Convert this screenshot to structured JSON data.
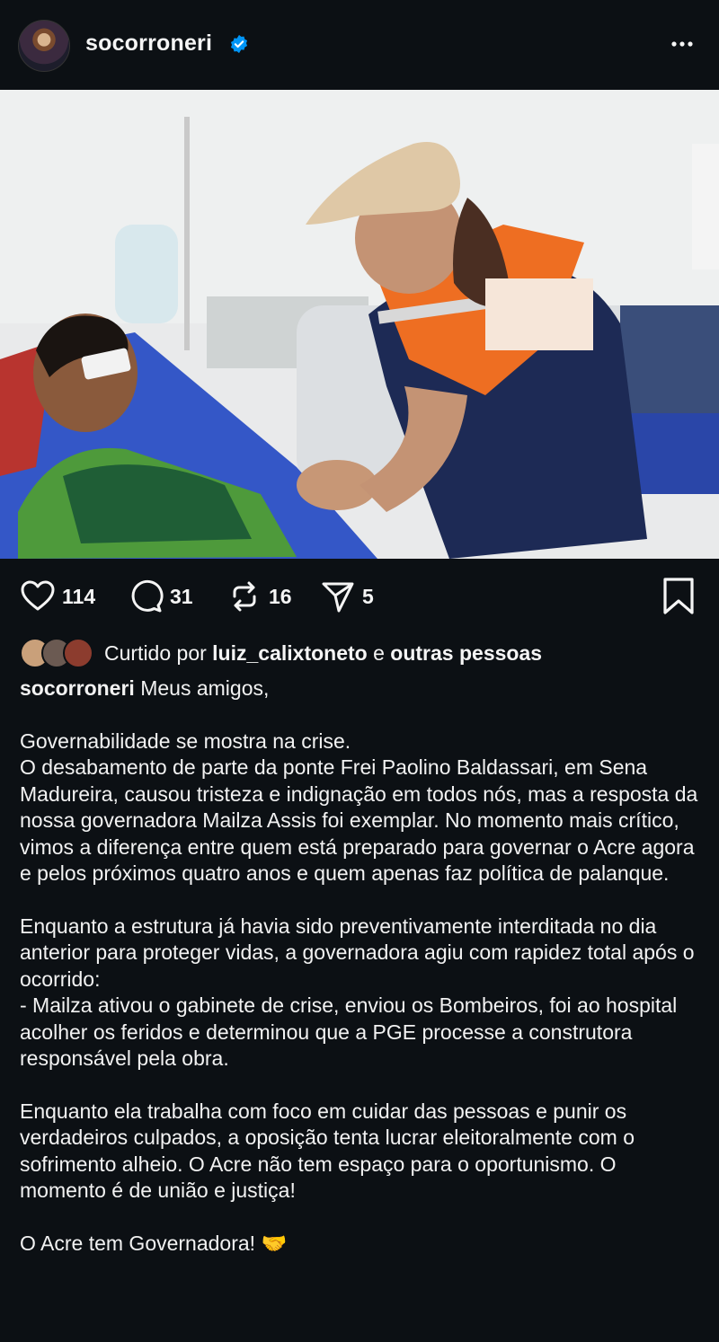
{
  "post": {
    "username": "socorroneri",
    "verified": true
  },
  "actions": {
    "likes": "114",
    "comments": "31",
    "reposts": "16",
    "shares": "5"
  },
  "liked_by": {
    "prefix": "Curtido por",
    "user": "luiz_calixtoneto",
    "connector": "e",
    "others": "outras pessoas"
  },
  "caption": {
    "author": "socorroneri",
    "first_line": "Meus amigos,",
    "paragraphs": [
      "Governabilidade se mostra na crise.",
      "O desabamento de parte da ponte Frei Paolino Baldassari, em Sena Madureira, causou tristeza e indignação em todos nós, mas a resposta da nossa governadora Mailza Assis foi exemplar. No momento mais crítico, vimos a diferença entre quem está preparado para governar o Acre agora e pelos próximos quatro anos e quem apenas faz política de palanque.",
      "Enquanto a estrutura já havia sido preventivamente interditada no dia anterior para proteger vidas, a governadora agiu com rapidez total após o ocorrido:",
      "- Mailza ativou o gabinete de crise, enviou os Bombeiros, foi ao hospital acolher os feridos e determinou que a PGE processe a construtora responsável pela obra.",
      "Enquanto ela trabalha com foco em cuidar das pessoas e punir os verdadeiros culpados, a oposição tenta lucrar eleitoralmente com o sofrimento alheio. O Acre não tem espaço para o oportunismo. O momento é de união e justiça!",
      "O Acre tem Governadora! 🤝"
    ]
  },
  "colors": {
    "background": "#0c1014",
    "verified_blue": "#0095f6",
    "text": "#f5f5f5"
  }
}
